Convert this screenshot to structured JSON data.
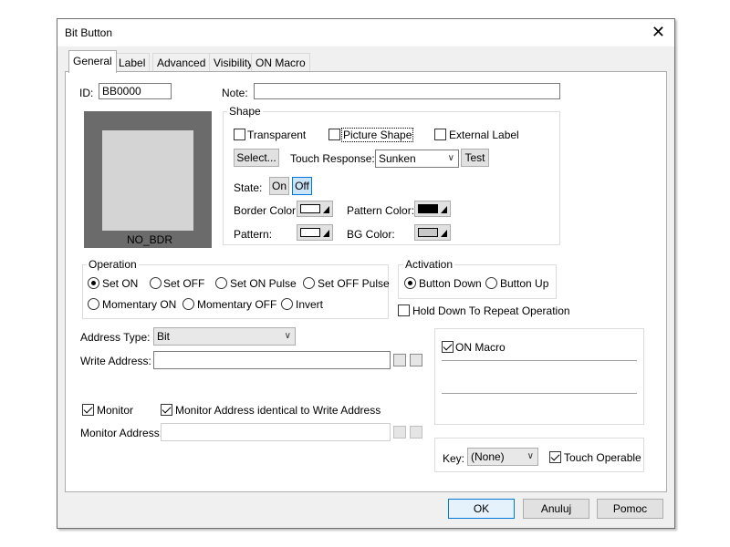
{
  "window": {
    "title": "Bit Button",
    "close_glyph": "✕"
  },
  "tabs": [
    "General",
    "Label",
    "Advanced",
    "Visibility",
    "ON Macro"
  ],
  "general": {
    "id_label": "ID:",
    "id_value": "BB0000",
    "note_label": "Note:",
    "note_value": "",
    "preview_caption": "NO_BDR",
    "shape": {
      "title": "Shape",
      "transparent": "Transparent",
      "picture_shape": "Picture Shape",
      "external_label": "External Label",
      "select_button": "Select...",
      "touch_response_label": "Touch Response:",
      "touch_response_value": "Sunken",
      "test_button": "Test",
      "state_label": "State:",
      "state_on": "On",
      "state_off": "Off",
      "border_color_label": "Border Color:",
      "pattern_color_label": "Pattern Color:",
      "pattern_label": "Pattern:",
      "bg_color_label": "BG Color:"
    },
    "operation": {
      "title": "Operation",
      "options": [
        "Set ON",
        "Set OFF",
        "Set ON Pulse",
        "Set OFF Pulse",
        "Momentary ON",
        "Momentary OFF",
        "Invert"
      ],
      "selected": "Set ON"
    },
    "activation": {
      "title": "Activation",
      "options": [
        "Button Down",
        "Button Up"
      ],
      "selected": "Button Down"
    },
    "hold_down": "Hold Down To Repeat Operation",
    "address_type_label": "Address Type:",
    "address_type_value": "Bit",
    "write_address_label": "Write Address:",
    "write_address_value": "",
    "monitor_label": "Monitor",
    "monitor_identical_label": "Monitor Address identical to Write Address",
    "monitor_address_label": "Monitor Address:",
    "monitor_address_value": "",
    "on_macro_label": "ON Macro",
    "key_label": "Key:",
    "key_value": "(None)",
    "touch_operable": "Touch Operable"
  },
  "buttons": {
    "ok": "OK",
    "cancel": "Anuluj",
    "help": "Pomoc"
  },
  "colors": {
    "preview_outer": "#6b6b6b",
    "preview_inner": "#d4d4d4",
    "border_color": "#ffffff",
    "pattern_color": "#000000",
    "pattern": "#ffffff",
    "bg_color": "#c8c8c8",
    "accent": "#0078d7"
  }
}
